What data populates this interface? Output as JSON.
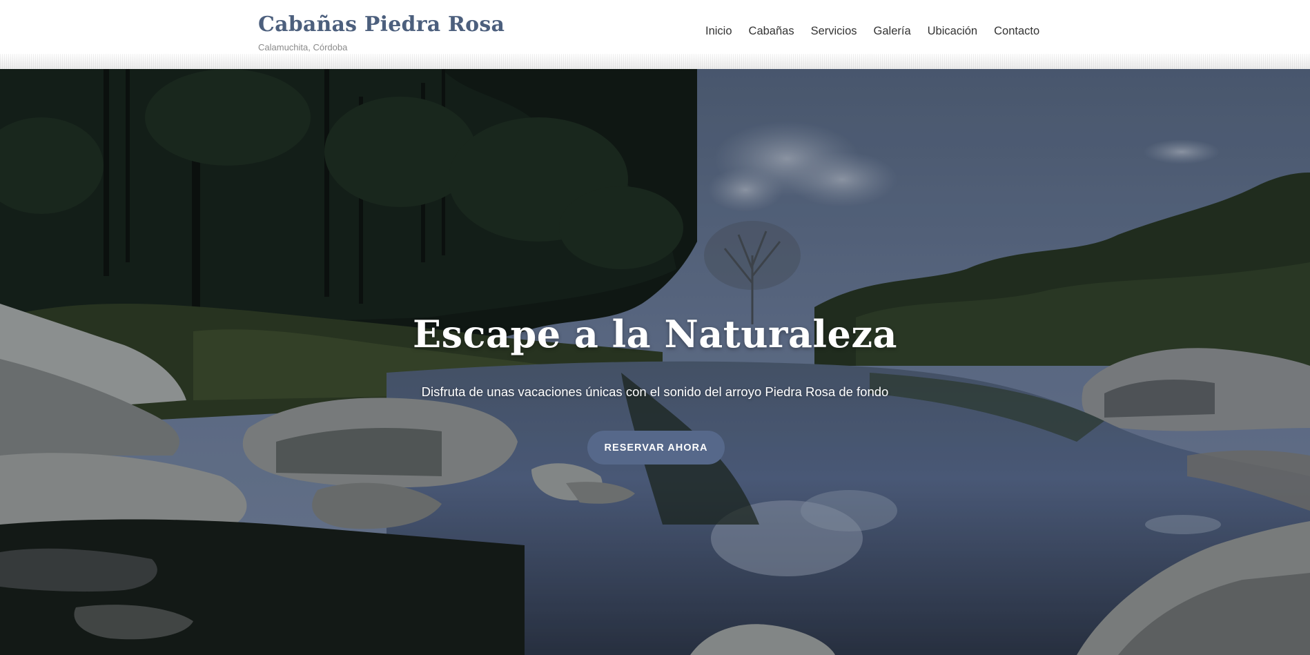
{
  "header": {
    "brand_title": "Cabañas Piedra Rosa",
    "brand_tagline": "Calamuchita, Córdoba"
  },
  "nav": {
    "items": [
      "Inicio",
      "Cabañas",
      "Servicios",
      "Galería",
      "Ubicación",
      "Contacto"
    ]
  },
  "hero": {
    "title": "Escape a la Naturaleza",
    "subtitle": "Disfruta de unas vacaciones únicas con el sonido del arroyo Piedra Rosa de fondo",
    "cta_label": "RESERVAR AHORA"
  },
  "colors": {
    "brand": "#4c5f7d",
    "cta_background": "#56688a",
    "nav_text": "#333333"
  }
}
